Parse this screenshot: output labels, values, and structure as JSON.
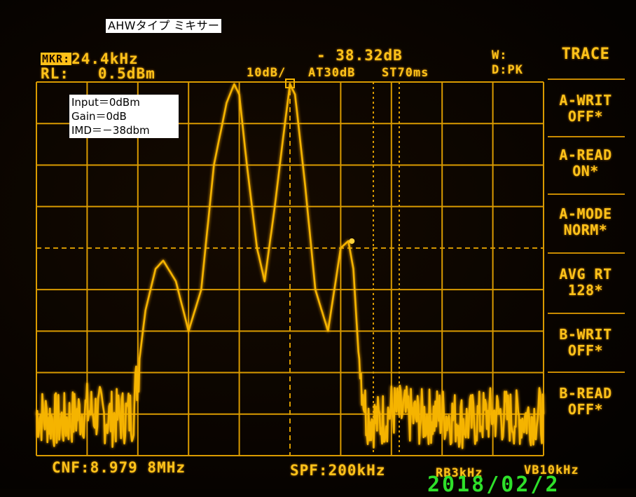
{
  "window": {
    "title_annotation": "AHWタイプ ミキサー"
  },
  "annotation_box": {
    "lines": [
      "Input＝0dBm",
      "Gain＝0dB",
      "IMD＝－38dbm"
    ]
  },
  "readout": {
    "marker_badge": "MKR:",
    "marker_freq": "24.4kHz",
    "marker_level": "- 38.32dB",
    "ref_level_label": "RL:",
    "ref_level_value": "0.5dBm",
    "scale": "10dB/",
    "attenuation": "AT30dB",
    "sweep_time": "ST70ms",
    "window_label": "W:",
    "detector": "D:PK"
  },
  "footer": {
    "center_freq": "CNF:8.979 8MHz",
    "span": "SPF:200kHz",
    "rbw": "RB3kHz",
    "vbw": "VB10kHz",
    "date_stamp": "2018/02/2"
  },
  "menu": {
    "title": "TRACE",
    "items": [
      {
        "line1": "A-WRIT",
        "line2": "OFF*"
      },
      {
        "line1": "A-READ",
        "line2": "ON*"
      },
      {
        "line1": "A-MODE",
        "line2": "NORM*"
      },
      {
        "line1": "AVG RT",
        "line2": "128*"
      },
      {
        "line1": "B-WRIT",
        "line2": "OFF*"
      },
      {
        "line1": "B-READ",
        "line2": "OFF*"
      }
    ]
  },
  "colors": {
    "trace": "#f5b400",
    "grid": "#d99a00",
    "background": "#060300",
    "date": "#2ee02a"
  },
  "chart_data": {
    "type": "line",
    "x": [
      -100,
      -90,
      -80,
      -70,
      -62,
      -60,
      -57,
      -53,
      -50,
      -45,
      -40,
      -35,
      -30,
      -25,
      -22,
      -20,
      -17,
      -13,
      -10,
      -6,
      -2,
      0,
      2,
      6,
      10,
      15,
      20,
      23,
      25,
      27,
      30,
      35,
      40,
      50,
      60,
      70,
      80,
      90,
      100
    ],
    "values": [
      -80,
      -82,
      -79,
      -81,
      -80,
      -70,
      -55,
      -45,
      -43,
      -48,
      -60,
      -50,
      -20,
      -5,
      -0.5,
      -3,
      -20,
      -40,
      -48,
      -30,
      -10,
      -0.5,
      -3,
      -25,
      -50,
      -60,
      -40,
      -38.3,
      -45,
      -65,
      -80,
      -82,
      -79,
      -81,
      -80,
      -82,
      -80,
      -81,
      -80
    ],
    "xlabel": "",
    "ylabel": "",
    "ylim": [
      -90,
      0
    ],
    "grid": true,
    "markers": [
      {
        "x": 24.4,
        "y": -38.32
      }
    ]
  }
}
